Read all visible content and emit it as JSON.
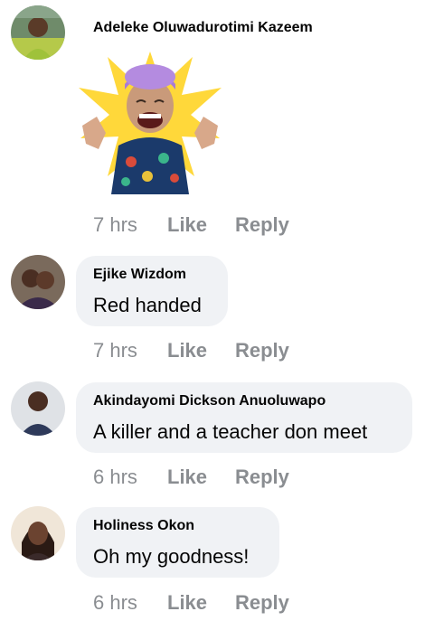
{
  "comments": [
    {
      "author": "Adeleke Oluwadurotimi Kazeem",
      "text": "",
      "sticker": "laughing-man-sticker",
      "time": "7 hrs",
      "like": "Like",
      "reply": "Reply"
    },
    {
      "author": "Ejike Wizdom",
      "text": "Red handed",
      "time": "7 hrs",
      "like": "Like",
      "reply": "Reply"
    },
    {
      "author": "Akindayomi Dickson Anuoluwapo",
      "text": "A killer and a teacher don meet",
      "time": "6 hrs",
      "like": "Like",
      "reply": "Reply"
    },
    {
      "author": "Holiness Okon",
      "text": "Oh my goodness!",
      "time": "6 hrs",
      "like": "Like",
      "reply": "Reply"
    }
  ],
  "colors": {
    "bubble": "#f0f2f5",
    "meta": "#8a8d91",
    "text": "#050505"
  }
}
